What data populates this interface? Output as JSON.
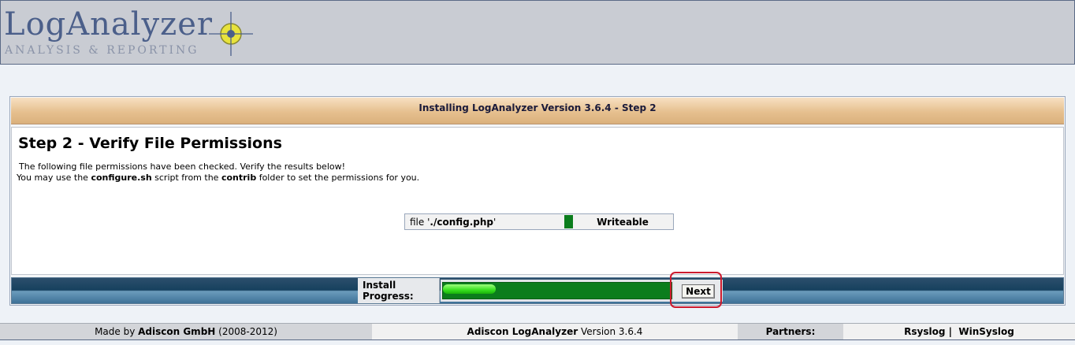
{
  "header": {
    "logo_title": "LogAnalyzer",
    "logo_subtitle": "ANALYSIS & REPORTING",
    "logo_mark_icon": "crosshair-target-icon"
  },
  "panel": {
    "title": "Installing LogAnalyzer Version 3.6.4 - Step 2",
    "step_heading": "Step 2 - Verify File Permissions",
    "desc_line1": "The following file permissions have been checked. Verify the results below!",
    "desc_line2": {
      "part1": "You may use the ",
      "script": "configure.sh",
      "part2": " script from the ",
      "folder": "contrib",
      "part3": " folder to set the permissions for you."
    },
    "permissions": [
      {
        "prefix": "file '",
        "path": "./config.php",
        "suffix": "'",
        "status": "Writeable",
        "status_color": "#0b7d1c"
      }
    ]
  },
  "progress": {
    "label": "Install Progress:",
    "fraction": 0.23,
    "next_label": "Next"
  },
  "footer": {
    "made_by_prefix": "Made by ",
    "made_by_company": "Adiscon GmbH",
    "made_by_years": " (2008-2012)",
    "product_name": "Adiscon LogAnalyzer",
    "product_version": " Version 3.6.4",
    "partners_label": "Partners:",
    "partner_links": [
      "Rsyslog",
      "WinSyslog"
    ],
    "separator": "|"
  },
  "colors": {
    "accent_green": "#0b7d1c",
    "highlight_red": "#cc1b2e",
    "header_bg": "#c9ccd3"
  }
}
